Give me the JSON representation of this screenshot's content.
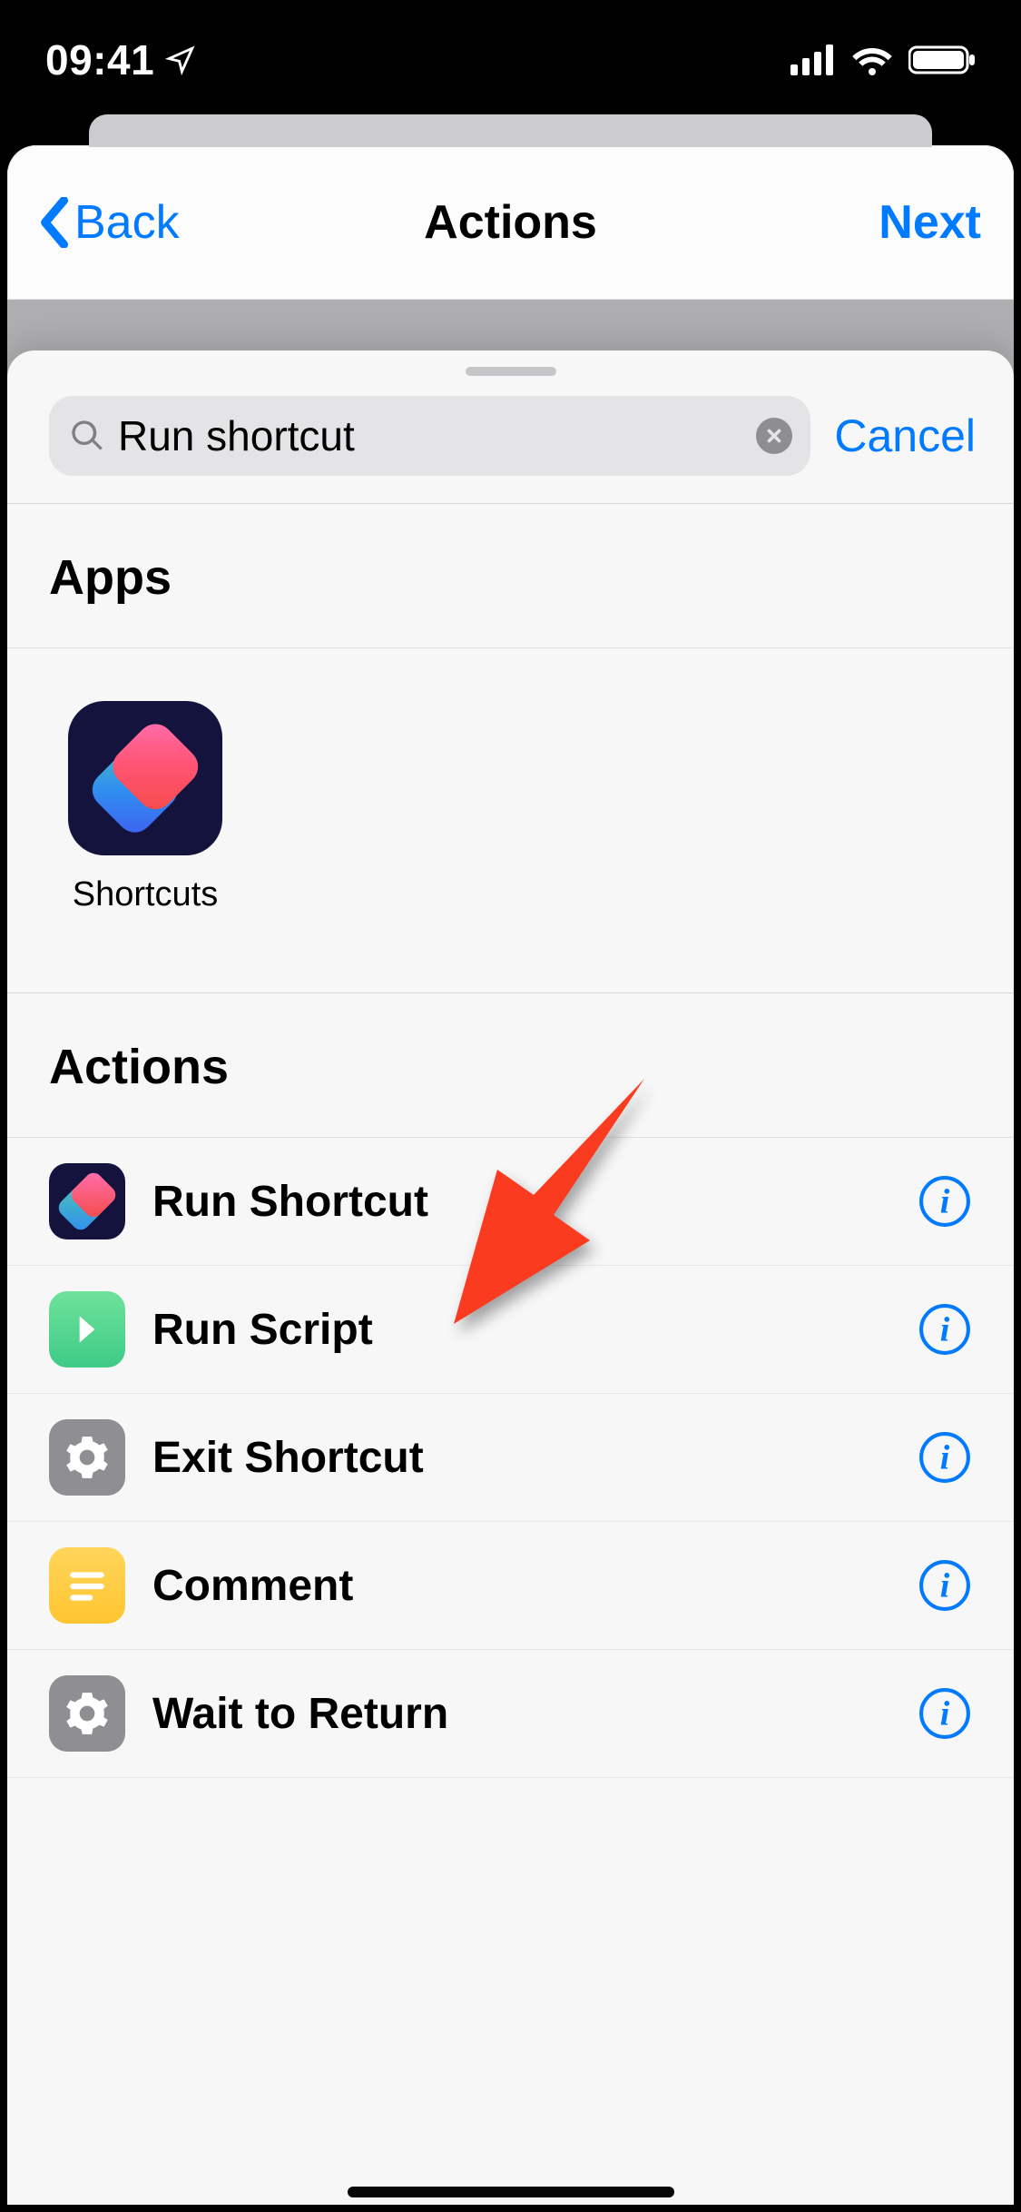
{
  "status": {
    "time": "09:41"
  },
  "nav": {
    "back": "Back",
    "title": "Actions",
    "next": "Next"
  },
  "search": {
    "text": "Run shortcut",
    "cancel": "Cancel"
  },
  "sections": {
    "apps_title": "Apps",
    "actions_title": "Actions"
  },
  "apps": [
    {
      "label": "Shortcuts"
    }
  ],
  "actions": [
    {
      "label": "Run Shortcut",
      "icon": "shortcuts"
    },
    {
      "label": "Run Script",
      "icon": "green"
    },
    {
      "label": "Exit Shortcut",
      "icon": "gear"
    },
    {
      "label": "Comment",
      "icon": "yellow"
    },
    {
      "label": "Wait to Return",
      "icon": "gear"
    }
  ],
  "annotation": {
    "points_to": "Run Shortcut"
  }
}
